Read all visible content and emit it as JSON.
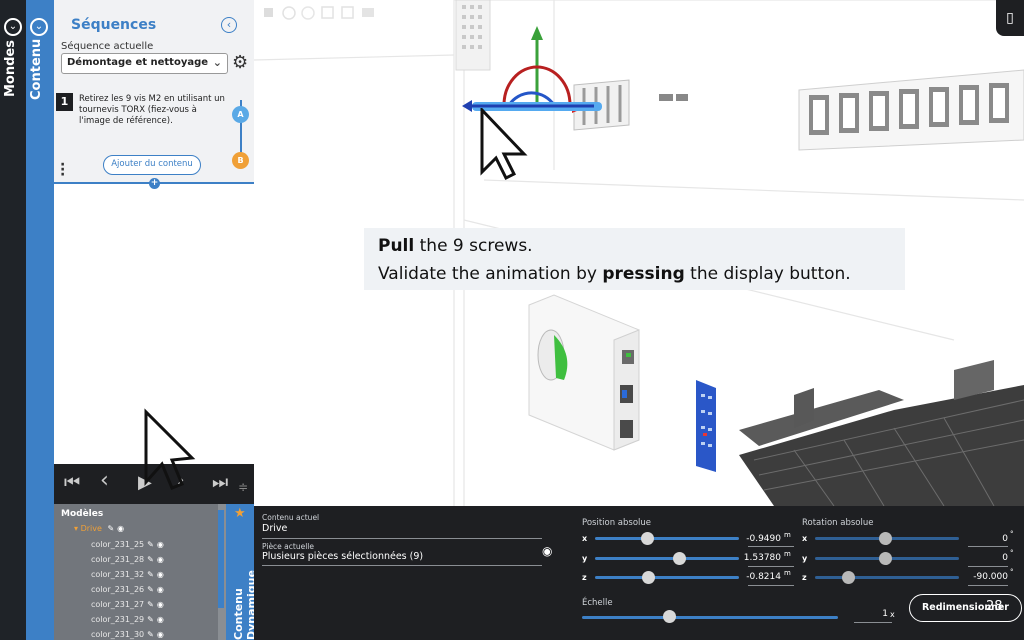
{
  "rails": {
    "mondes": "Mondes",
    "contenu": "Contenu"
  },
  "sequences": {
    "title": "Séquences",
    "current_label": "Séquence actuelle",
    "current_value": "Démontage et nettoyage",
    "step_number": "1",
    "step_text": "Retirez les 9 vis M2 en utilisant un tournevis TORX (fiez-vous à l'image de référence).",
    "badge_a": "A",
    "badge_b": "B",
    "add_content": "Ajouter du contenu",
    "plus": "+"
  },
  "icons": {
    "collapse": "chevron-left-icon",
    "gear": "gear-icon",
    "eye": "eye-icon",
    "star": "star-icon",
    "phone": "phone-icon"
  },
  "models": {
    "title": "Modèles",
    "root": "Drive",
    "items": [
      "color_231_25",
      "color_231_28",
      "color_231_32",
      "color_231_26",
      "color_231_27",
      "color_231_29",
      "color_231_30"
    ]
  },
  "dynamic_rail": {
    "label": "Contenu Dynamique"
  },
  "instruction": {
    "line1_bold": "Pull",
    "line1_rest": " the 9 screws.",
    "line2_pre": "Validate the animation by ",
    "line2_bold": "pressing",
    "line2_post": " the display button."
  },
  "properties": {
    "current_content_label": "Contenu actuel",
    "current_content_value": "Drive",
    "current_part_label": "Pièce actuelle",
    "current_part_value": "Plusieurs pièces sélectionnées (9)",
    "position_label": "Position absolue",
    "rotation_label": "Rotation absolue",
    "scale_label": "Échelle",
    "axes": [
      "x",
      "y",
      "z"
    ],
    "position_values": [
      "-0.9490",
      "1.53780",
      "-0.8214"
    ],
    "position_unit": "m",
    "rotation_values": [
      "0",
      "0",
      "-90.000"
    ],
    "rotation_unit": "°",
    "scale_value": "1",
    "scale_unit": "x",
    "resize_button": "Redimensionner",
    "frame_number": "28"
  },
  "colors": {
    "accent_blue": "#3d80c6",
    "dark": "#1e1f22",
    "orange": "#f0a037",
    "panel_grey": "#72767c"
  }
}
